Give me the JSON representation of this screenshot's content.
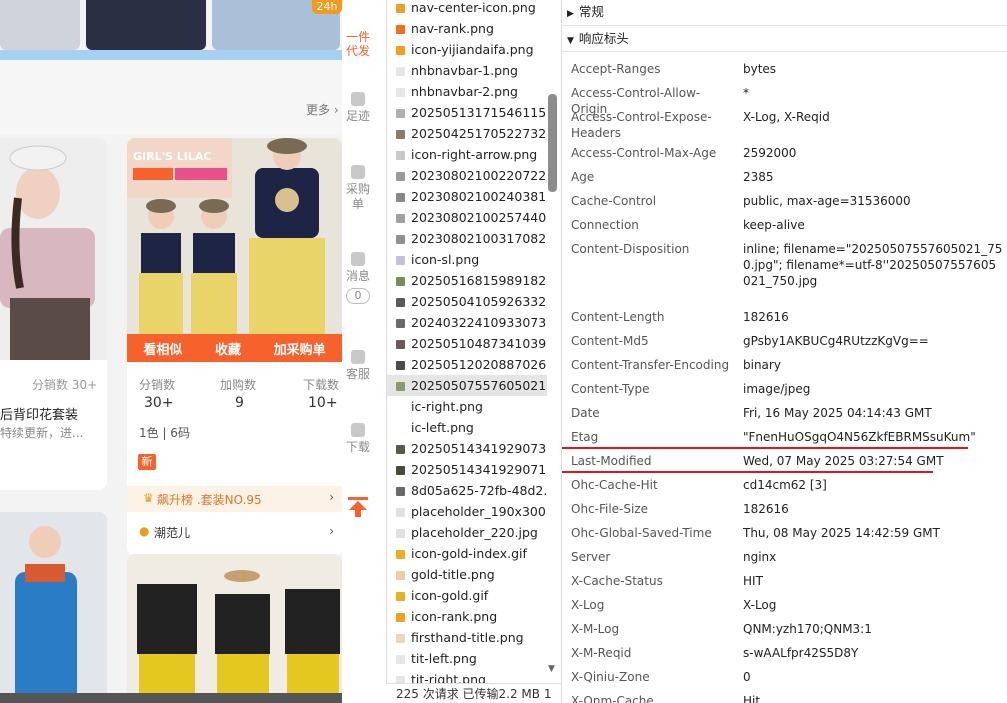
{
  "shop": {
    "badge_24h": "24h",
    "daifa_label": "一件代发",
    "more_label": "更多 ›",
    "card1": {
      "sales_label": "分销数 30+",
      "title": "后背印花套装",
      "desc": "特续更新，进..."
    },
    "card2": {
      "banner_text": "GIRL'S LILAC",
      "actions": [
        "看相似",
        "收藏",
        "加采购单"
      ],
      "stats": [
        {
          "label": "分销数",
          "value": "30+"
        },
        {
          "label": "加购数",
          "value": "9"
        },
        {
          "label": "下载数",
          "value": "10+"
        }
      ],
      "spec": "1色 | 6码",
      "new_tag": "新",
      "rank_text": "飙升榜 .套装NO.95",
      "brand_text": "潮范儿"
    }
  },
  "sidetools": [
    {
      "label": "足迹",
      "icon": "footprint-icon"
    },
    {
      "label": "采购单",
      "icon": "clipboard-icon"
    },
    {
      "label": "消息",
      "icon": "bell-icon",
      "count": "0"
    },
    {
      "label": "客服",
      "icon": "headset-icon"
    },
    {
      "label": "下载",
      "icon": "grid-icon"
    }
  ],
  "network": {
    "files": [
      {
        "name": "nav-center-icon.png",
        "color": "#f0a020"
      },
      {
        "name": "nav-rank.png",
        "color": "#f07020"
      },
      {
        "name": "icon-yijiandaifa.png",
        "color": "#f0a020"
      },
      {
        "name": "nhbnavbar-1.png",
        "color": "#e6e6e6"
      },
      {
        "name": "nhbnavbar-2.png",
        "color": "#e6e6e6"
      },
      {
        "name": "20250513171546115...",
        "color": "#b0b0b0"
      },
      {
        "name": "20250425170522732...",
        "color": "#8a7c6a"
      },
      {
        "name": "icon-right-arrow.png",
        "color": "#c8c8c8"
      },
      {
        "name": "20230802100220722...",
        "color": "#9a9a9a"
      },
      {
        "name": "20230802100240381...",
        "color": "#8a8a8a"
      },
      {
        "name": "20230802100257440...",
        "color": "#a0a0a0"
      },
      {
        "name": "20230802100317082...",
        "color": "#909090"
      },
      {
        "name": "icon-sl.png",
        "color": "#c0c0d8"
      },
      {
        "name": "20250516815989182...",
        "color": "#7a8a5a"
      },
      {
        "name": "20250504105926332...",
        "color": "#5a5a5a"
      },
      {
        "name": "20240322410933073...",
        "color": "#6a6a6a"
      },
      {
        "name": "20250510487341039...",
        "color": "#6a5a5a"
      },
      {
        "name": "20250512020887026...",
        "color": "#4a4a4a"
      },
      {
        "name": "20250507557605021...",
        "color": "#8a9a6a",
        "selected": true
      },
      {
        "name": "ic-right.png",
        "color": "#ffffff"
      },
      {
        "name": "ic-left.png",
        "color": "#ffffff"
      },
      {
        "name": "20250514341929073...",
        "color": "#5a5a4a"
      },
      {
        "name": "20250514341929071...",
        "color": "#4a4a3a"
      },
      {
        "name": "8d05a625-72fb-48d2...",
        "color": "#6a6a6a"
      },
      {
        "name": "placeholder_190x300...",
        "color": "#e0e0e0"
      },
      {
        "name": "placeholder_220.jpg",
        "color": "#e0e0e0"
      },
      {
        "name": "icon-gold-index.gif",
        "color": "#e8b020"
      },
      {
        "name": "gold-title.png",
        "color": "#e8d0a0"
      },
      {
        "name": "icon-gold.gif",
        "color": "#e8b020"
      },
      {
        "name": "icon-rank.png",
        "color": "#f0a020"
      },
      {
        "name": "firsthand-title.png",
        "color": "#e8d8c0"
      },
      {
        "name": "tit-left.png",
        "color": "#e6e6e6"
      },
      {
        "name": "tit-right.png",
        "color": "#e6e6e6"
      }
    ],
    "footer": "225 次请求  已传输2.2 MB  1"
  },
  "headers_panel": {
    "general_label": "常规",
    "response_label": "响应标头",
    "items": [
      {
        "key": "Accept-Ranges",
        "value": "bytes"
      },
      {
        "key": "Access-Control-Allow-Origin",
        "value": "*"
      },
      {
        "key": "Access-Control-Expose-Headers",
        "value": "X-Log, X-Reqid"
      },
      {
        "key": "Access-Control-Max-Age",
        "value": "2592000"
      },
      {
        "key": "Age",
        "value": "2385"
      },
      {
        "key": "Cache-Control",
        "value": "public, max-age=31536000"
      },
      {
        "key": "Connection",
        "value": "keep-alive"
      },
      {
        "key": "Content-Disposition",
        "value": "inline; filename=\"20250507557605021_750.jpg\"; filename*=utf-8''20250507557605021_750.jpg"
      },
      {
        "key": "Content-Length",
        "value": "182616"
      },
      {
        "key": "Content-Md5",
        "value": "gPsby1AKBUCg4RUtzzKgVg=="
      },
      {
        "key": "Content-Transfer-Encoding",
        "value": "binary"
      },
      {
        "key": "Content-Type",
        "value": "image/jpeg"
      },
      {
        "key": "Date",
        "value": "Fri, 16 May 2025 04:14:43 GMT"
      },
      {
        "key": "Etag",
        "value": "\"FnenHuOSgqO4N56ZkfEBRMSsuKum\""
      },
      {
        "key": "Last-Modified",
        "value": "Wed, 07 May 2025 03:27:54 GMT"
      },
      {
        "key": "Ohc-Cache-Hit",
        "value": "cd14cm62 [3]"
      },
      {
        "key": "Ohc-File-Size",
        "value": "182616"
      },
      {
        "key": "Ohc-Global-Saved-Time",
        "value": "Thu, 08 May 2025 14:42:59 GMT"
      },
      {
        "key": "Server",
        "value": "nginx"
      },
      {
        "key": "X-Cache-Status",
        "value": "HIT"
      },
      {
        "key": "X-Log",
        "value": "X-Log"
      },
      {
        "key": "X-M-Log",
        "value": "QNM:yzh170;QNM3:1"
      },
      {
        "key": "X-M-Reqid",
        "value": "s-wAALfpr42S5D8Y"
      },
      {
        "key": "X-Qiniu-Zone",
        "value": "0"
      },
      {
        "key": "X-Qnm-Cache",
        "value": "Hit"
      }
    ]
  },
  "colors": {
    "accent_orange": "#f7612b",
    "annotation_red": "#e0141e"
  }
}
